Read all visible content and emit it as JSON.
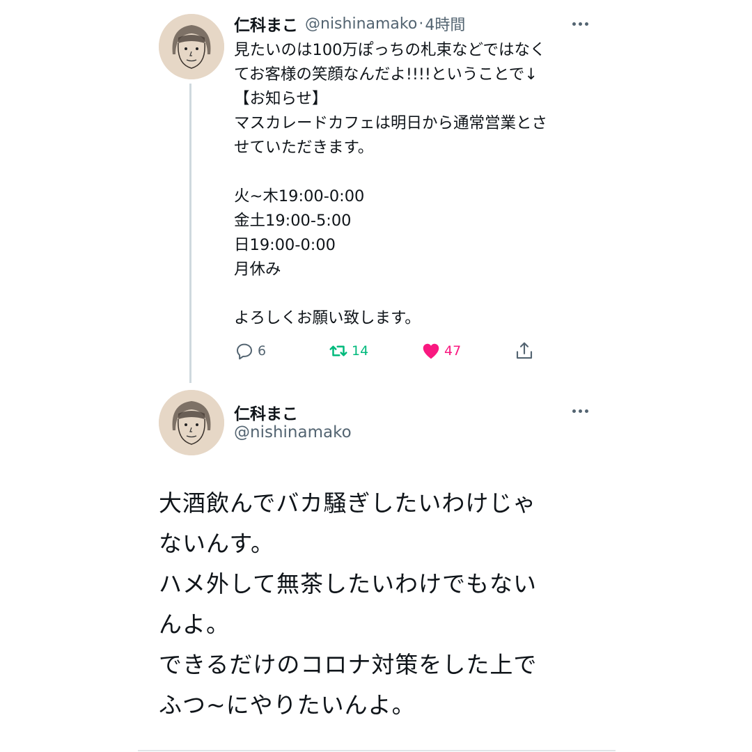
{
  "colors": {
    "text_primary": "#0f1419",
    "text_secondary": "#536471",
    "retweet_green": "#00ba7c",
    "like_pink": "#f91880",
    "thread_line": "#cfd9de"
  },
  "tweet1": {
    "display_name": "仁科まこ",
    "handle": "@nishinamako",
    "separator": "·",
    "time": "4時間",
    "body_lines": [
      "見たいのは100万ぽっちの札束などではなく",
      "てお客様の笑顔なんだよ!!!!ということで↓",
      "【お知らせ】",
      "マスカレードカフェは明日から通常営業とさ",
      "せていただきます。",
      "",
      "火~木19:00-0:00",
      "金土19:00-5:00",
      "日19:00-0:00",
      "月休み",
      "",
      "よろしくお願い致します。"
    ],
    "actions": {
      "reply_icon": "reply-icon",
      "reply_count": "6",
      "retweet_icon": "retweet-icon",
      "retweet_count": "14",
      "like_icon": "heart-filled-icon",
      "like_count": "47",
      "share_icon": "share-icon"
    }
  },
  "tweet2": {
    "display_name": "仁科まこ",
    "handle": "@nishinamako",
    "body_lines": [
      "大酒飲んでバカ騒ぎしたいわけじゃ",
      "ないんす。",
      "ハメ外して無茶したいわけでもない",
      "んよ。",
      "できるだけのコロナ対策をした上で",
      "ふつ~にやりたいんよ。"
    ]
  }
}
